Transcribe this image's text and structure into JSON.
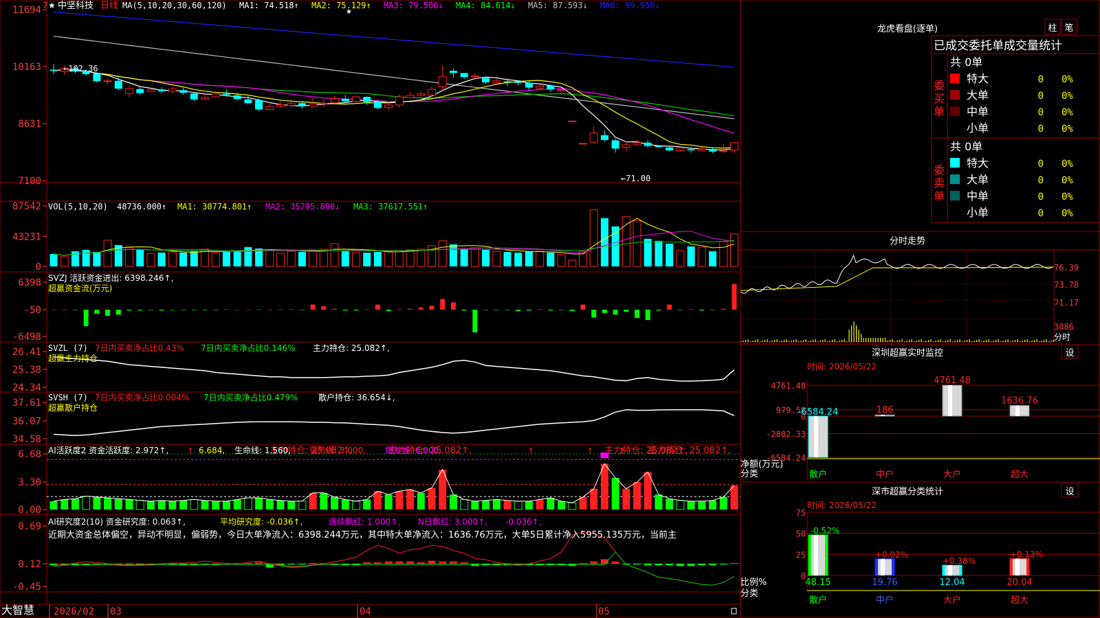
{
  "colors": {
    "up": "#ff2020",
    "down": "#00ffff",
    "grid": "#9b0000",
    "axisText": "#ff3b3b",
    "white": "#ffffff",
    "yellow": "#ffff00",
    "magenta": "#ff00ff",
    "green": "#00ff00",
    "blue": "#2020ff",
    "gray": "#c0c0c0"
  },
  "header": {
    "star": "★",
    "name": "中坚科技",
    "period": "日线",
    "ma_label": "MA(5,10,20,30,60,120)",
    "ma": [
      {
        "label": "MA1: 74.518↑",
        "color": "#ffffff"
      },
      {
        "label": "MA2: 75.129↑",
        "color": "#ffff00"
      },
      {
        "label": "MA3: 79.506↓",
        "color": "#ff00ff"
      },
      {
        "label": "MA4: 84.614↓",
        "color": "#00ff00"
      },
      {
        "label": "MA5: 87.593↓",
        "color": "#c0c0c0"
      },
      {
        "label": "MA6: 99.956↓",
        "color": "#2020ff"
      }
    ]
  },
  "price_axis": {
    "ticks": [
      "11694",
      "10163",
      "8631",
      "7100"
    ],
    "marker": "7"
  },
  "price_annot": {
    "high": "←102.36",
    "low": "←71.00"
  },
  "vol": {
    "label": "VOL(5,10,20)",
    "value": "48736.000↑",
    "ma1": "MA1: 30774.801↑",
    "ma2": "MA2: 35795.898↓",
    "ma3": "MA3: 37617.551↑",
    "ticks": [
      "87542",
      "43231",
      "0"
    ]
  },
  "svzj": {
    "label": "SVZJ  活跃资金进出: 6398.246↑,",
    "sub": "超赢资金流(万元)",
    "ticks": [
      "6398",
      "-50",
      "-6498"
    ]
  },
  "svzl": {
    "label": "SVZL (7)",
    "t1": "7日内买卖净占比0.43%",
    "t2": "7日内买卖净占比0.146%",
    "t3": "主力持仓: 25.082↑,",
    "sub": "超赢主力持仓",
    "ticks": [
      "26.41",
      "25.38",
      "24.34"
    ]
  },
  "svsh": {
    "label": "SVSH (7)",
    "t1": "7日内买卖净占比0.004%",
    "t2": "7日内买卖净占比0.479%",
    "t3": "散户持仓: 36.654↓,",
    "sub": "超赢散户持仓",
    "ticks": [
      "37.61",
      "36.07",
      "34.58"
    ]
  },
  "ai1": {
    "label": "AI活跃度2 资金活跃度: 2.972↑,",
    "v2": "6.684,",
    "v3": "生命线: 1.560,",
    "v4": "强势线: 3.000,",
    "v5": "爆发线: 6.000,",
    "ticks": [
      "6.68",
      "3.30",
      "0.00"
    ]
  },
  "ai2": {
    "label": "AI研究度2(10) 资金研究度: 0.063↑,",
    "v2": "平均研究度: -0.036↑,",
    "v3": "连续飘红: 1.000↑,",
    "v4": "N日飘红: 3.000↑,",
    "v5": "-0.036↑,",
    "desc": "近期大资金总体偏空，异动不明显，偏弱势，今日大单净流入：6398.244万元，其中特大单净流入：1636.76万元，大单5日累计净入5955.135万元，当前主",
    "ticks": [
      "0.69",
      "0.12",
      "-0.45"
    ]
  },
  "date_axis": {
    "brand": "大智慧",
    "labels": [
      "2026/02",
      "03",
      "04",
      "05"
    ]
  },
  "right": {
    "lhb": {
      "title": "龙虎看盘(逐单)",
      "btn1": "柱",
      "btn2": "笔",
      "header": "已成交委托单成交量统计",
      "buy": {
        "side": "委买单",
        "total": "共 0单",
        "rows": [
          {
            "name": "特大",
            "n": "0",
            "p": "0%",
            "c": "#ff0000"
          },
          {
            "name": "大单",
            "n": "0",
            "p": "0%",
            "c": "#a00000"
          },
          {
            "name": "中单",
            "n": "0",
            "p": "0%",
            "c": "#600000"
          },
          {
            "name": "小单",
            "n": "0",
            "p": "0%",
            "c": "#000000"
          }
        ]
      },
      "sell": {
        "side": "委卖单",
        "total": "共 0单",
        "rows": [
          {
            "name": "特大",
            "n": "0",
            "p": "0%",
            "c": "#00ffff"
          },
          {
            "name": "大单",
            "n": "0",
            "p": "0%",
            "c": "#009090"
          },
          {
            "name": "中单",
            "n": "0",
            "p": "0%",
            "c": "#006060"
          },
          {
            "name": "小单",
            "n": "0",
            "p": "0%",
            "c": "#000000"
          }
        ]
      }
    },
    "fenshi": {
      "title": "分时走势",
      "ticks": [
        "76.39",
        "73.78",
        "71.17",
        "3086"
      ],
      "vol_label": "分时"
    },
    "sz": {
      "title": "深圳超赢实时监控",
      "btn": "设",
      "time": "时间: 2026/05/22",
      "ylabel": "净额(万元)",
      "xlabel": "分类",
      "ticks": [
        "4761.48",
        "979.58",
        "0",
        "-2802.33",
        "-6584.24"
      ],
      "cats": [
        "散户",
        "中户",
        "大户",
        "超大"
      ],
      "values": [
        -6584.24,
        186,
        4761.48,
        1636.76
      ],
      "labels": [
        "-6584.24",
        "186",
        "4761.48",
        "1636.76"
      ]
    },
    "ss": {
      "title": "深市超赢分类统计",
      "btn": "设",
      "time": "时间: 2026/05/22",
      "ylabel": "比例%",
      "xlabel": "分类",
      "ticks": [
        "75",
        "50",
        "25",
        "0"
      ],
      "cats": [
        "散户",
        "中户",
        "大户",
        "超大"
      ],
      "values": [
        48.15,
        19.76,
        12.04,
        20.04
      ],
      "top": [
        "-0.52%",
        "+0.02%",
        "+0.38%",
        "+0.13%"
      ],
      "bottom": [
        "48.15",
        "19.76",
        "12.04",
        "20.04"
      ]
    }
  },
  "chart_data": {
    "type": "candlestick",
    "title": "中坚科技 日线",
    "x_labels": [
      "2026/02",
      "03",
      "04",
      "05"
    ],
    "ylim": [
      71.0,
      116.94
    ],
    "candles": [
      [
        100.8,
        100.5,
        102.36,
        99.6
      ],
      [
        100.3,
        101.2,
        101.9,
        99.4
      ],
      [
        101.1,
        100.3,
        101.6,
        99.8
      ],
      [
        100.5,
        99.6,
        101.0,
        99.1
      ],
      [
        99.8,
        97.7,
        100.1,
        97.4
      ],
      [
        97.7,
        97.8,
        98.4,
        96.9
      ],
      [
        97.8,
        95.7,
        98.9,
        95.3
      ],
      [
        94.4,
        95.7,
        96.5,
        93.4
      ],
      [
        95.6,
        94.5,
        96.2,
        94.0
      ],
      [
        94.9,
        95.4,
        95.8,
        94.7
      ],
      [
        95.5,
        95.0,
        96.1,
        94.5
      ],
      [
        95.0,
        95.6,
        96.3,
        94.6
      ],
      [
        95.3,
        94.6,
        95.9,
        94.1
      ],
      [
        94.4,
        92.8,
        94.9,
        92.3
      ],
      [
        92.9,
        93.3,
        94.7,
        92.5
      ],
      [
        93.5,
        94.3,
        95.2,
        93.3
      ],
      [
        94.3,
        94.1,
        95.5,
        93.6
      ],
      [
        93.9,
        92.9,
        94.6,
        92.6
      ],
      [
        92.8,
        91.8,
        93.7,
        91.5
      ],
      [
        92.6,
        90.1,
        93.0,
        89.7
      ],
      [
        90.1,
        90.9,
        92.0,
        89.8
      ],
      [
        90.9,
        91.4,
        92.3,
        90.6
      ],
      [
        91.2,
        91.7,
        92.8,
        90.5
      ],
      [
        91.8,
        91.0,
        92.3,
        90.4
      ],
      [
        91.0,
        91.6,
        93.3,
        90.8
      ],
      [
        91.6,
        91.8,
        92.8,
        90.6
      ],
      [
        91.9,
        93.0,
        93.8,
        91.4
      ],
      [
        93.0,
        92.3,
        94.0,
        92.0
      ],
      [
        92.3,
        93.5,
        93.9,
        91.8
      ],
      [
        93.5,
        92.1,
        93.6,
        91.4
      ],
      [
        92.3,
        90.5,
        92.6,
        90.1
      ],
      [
        90.6,
        91.3,
        92.0,
        89.9
      ],
      [
        91.3,
        93.5,
        94.1,
        90.6
      ],
      [
        93.3,
        93.9,
        94.8,
        93.1
      ],
      [
        93.9,
        94.3,
        94.9,
        93.5
      ],
      [
        94.0,
        95.5,
        96.3,
        93.6
      ],
      [
        96.2,
        98.9,
        101.8,
        95.1
      ],
      [
        100.5,
        99.9,
        101.2,
        98.7
      ],
      [
        99.9,
        98.8,
        99.6,
        98.3
      ],
      [
        99.1,
        99.1,
        99.9,
        98.1
      ],
      [
        98.6,
        97.4,
        98.9,
        96.9
      ],
      [
        97.3,
        97.8,
        98.3,
        96.6
      ],
      [
        97.7,
        97.5,
        98.5,
        96.4
      ],
      [
        97.5,
        97.3,
        97.9,
        96.5
      ],
      [
        97.3,
        96.0,
        97.7,
        95.2
      ],
      [
        95.8,
        96.4,
        97.0,
        95.3
      ],
      [
        96.5,
        95.5,
        96.8,
        94.9
      ],
      [
        95.4,
        95.4,
        95.6,
        95.2
      ],
      [
        87.0,
        87.0,
        87.0,
        87.0
      ],
      [
        81.0,
        81.0,
        81.0,
        81.0
      ],
      [
        81.3,
        83.8,
        85.6,
        80.8
      ],
      [
        83.2,
        81.9,
        84.5,
        81.5
      ],
      [
        81.8,
        79.6,
        82.3,
        78.5
      ],
      [
        79.9,
        80.6,
        81.5,
        78.7
      ],
      [
        80.6,
        81.2,
        81.9,
        80.3
      ],
      [
        81.2,
        80.3,
        81.9,
        79.8
      ],
      [
        80.3,
        80.0,
        80.6,
        79.9
      ],
      [
        79.9,
        79.1,
        80.1,
        78.8
      ],
      [
        79.0,
        79.8,
        80.1,
        78.7
      ],
      [
        79.4,
        79.2,
        80.0,
        78.5
      ],
      [
        79.1,
        79.5,
        79.9,
        78.9
      ],
      [
        79.5,
        78.8,
        80.0,
        78.4
      ],
      [
        78.8,
        79.0,
        80.9,
        78.4
      ],
      [
        79.2,
        81.2,
        81.2,
        78.4
      ]
    ]
  }
}
